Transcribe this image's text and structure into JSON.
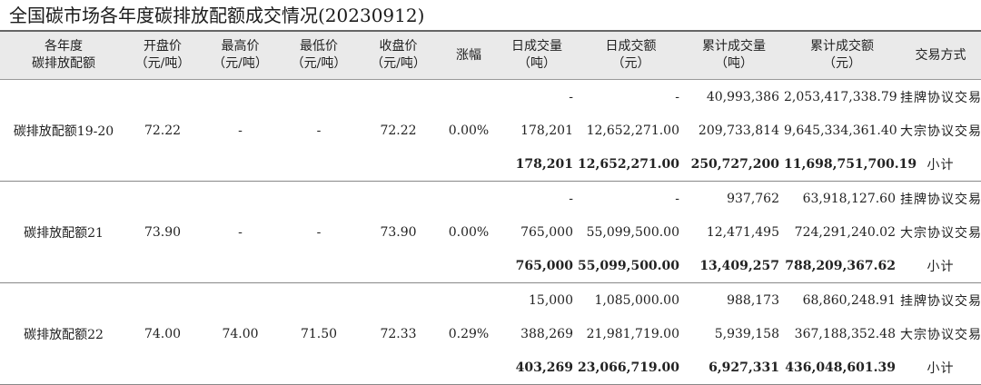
{
  "title": "全国碳市场各年度碳排放配额成交情况(20230912)",
  "headers": [
    {
      "l1": "各年度",
      "l2": "碳排放配额"
    },
    {
      "l1": "开盘价",
      "l2": "（元/吨）"
    },
    {
      "l1": "最高价",
      "l2": "（元/吨）"
    },
    {
      "l1": "最低价",
      "l2": "（元/吨）"
    },
    {
      "l1": "收盘价",
      "l2": "（元/吨）"
    },
    {
      "l1": "涨幅",
      "l2": ""
    },
    {
      "l1": "日成交量",
      "l2": "（吨）"
    },
    {
      "l1": "日成交额",
      "l2": "（元）"
    },
    {
      "l1": "累计成交量",
      "l2": "（吨）"
    },
    {
      "l1": "累计成交额",
      "l2": "（元）"
    },
    {
      "l1": "交易方式",
      "l2": ""
    }
  ],
  "groups": [
    {
      "name": "碳排放配额19-20",
      "open": "72.22",
      "high": "-",
      "low": "-",
      "close": "72.22",
      "change": "0.00%",
      "rows": [
        {
          "vol": "-",
          "amt": "-",
          "cum_vol": "40,993,386",
          "cum_amt": "2,053,417,338.79",
          "method": "挂牌协议交易"
        },
        {
          "vol": "178,201",
          "amt": "12,652,271.00",
          "cum_vol": "209,733,814",
          "cum_amt": "9,645,334,361.40",
          "method": "大宗协议交易"
        },
        {
          "vol": "178,201",
          "amt": "12,652,271.00",
          "cum_vol": "250,727,200",
          "cum_amt": "11,698,751,700.19",
          "method": "小计"
        }
      ]
    },
    {
      "name": "碳排放配额21",
      "open": "73.90",
      "high": "-",
      "low": "-",
      "close": "73.90",
      "change": "0.00%",
      "rows": [
        {
          "vol": "-",
          "amt": "-",
          "cum_vol": "937,762",
          "cum_amt": "63,918,127.60",
          "method": "挂牌协议交易"
        },
        {
          "vol": "765,000",
          "amt": "55,099,500.00",
          "cum_vol": "12,471,495",
          "cum_amt": "724,291,240.02",
          "method": "大宗协议交易"
        },
        {
          "vol": "765,000",
          "amt": "55,099,500.00",
          "cum_vol": "13,409,257",
          "cum_amt": "788,209,367.62",
          "method": "小计"
        }
      ]
    },
    {
      "name": "碳排放配额22",
      "open": "74.00",
      "high": "74.00",
      "low": "71.50",
      "close": "72.33",
      "change": "0.29%",
      "rows": [
        {
          "vol": "15,000",
          "amt": "1,085,000.00",
          "cum_vol": "988,173",
          "cum_amt": "68,860,248.91",
          "method": "挂牌协议交易"
        },
        {
          "vol": "388,269",
          "amt": "21,981,719.00",
          "cum_vol": "5,939,158",
          "cum_amt": "367,188,352.48",
          "method": "大宗协议交易"
        },
        {
          "vol": "403,269",
          "amt": "23,066,719.00",
          "cum_vol": "6,927,331",
          "cum_amt": "436,048,601.39",
          "method": "小计"
        }
      ]
    }
  ]
}
